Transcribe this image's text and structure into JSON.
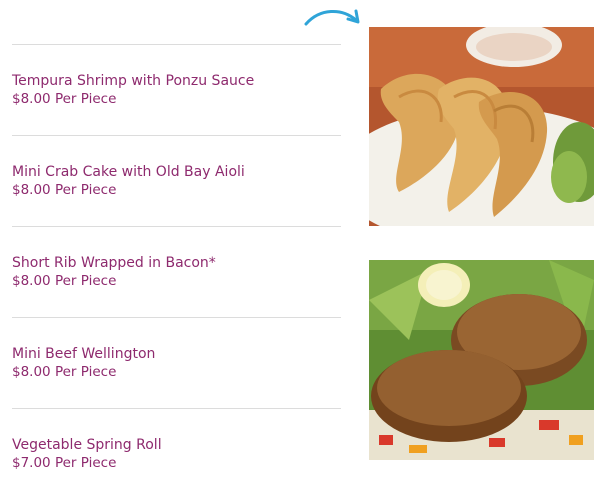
{
  "menu": {
    "items": [
      {
        "name": "Tempura Shrimp with Ponzu Sauce",
        "price": "$8.00 Per Piece"
      },
      {
        "name": "Mini Crab Cake with Old Bay Aioli",
        "price": "$8.00 Per Piece"
      },
      {
        "name": "Short Rib Wrapped in Bacon*",
        "price": "$8.00 Per Piece"
      },
      {
        "name": "Mini Beef Wellington",
        "price": "$8.00 Per Piece"
      },
      {
        "name": "Vegetable Spring Roll",
        "price": "$7.00 Per Piece"
      }
    ]
  },
  "colors": {
    "item_text": "#8e2a6e",
    "divider": "#dcdcdc",
    "arrow": "#2fa4d8"
  },
  "icons": {
    "arrow": "curved-arrow-icon"
  }
}
